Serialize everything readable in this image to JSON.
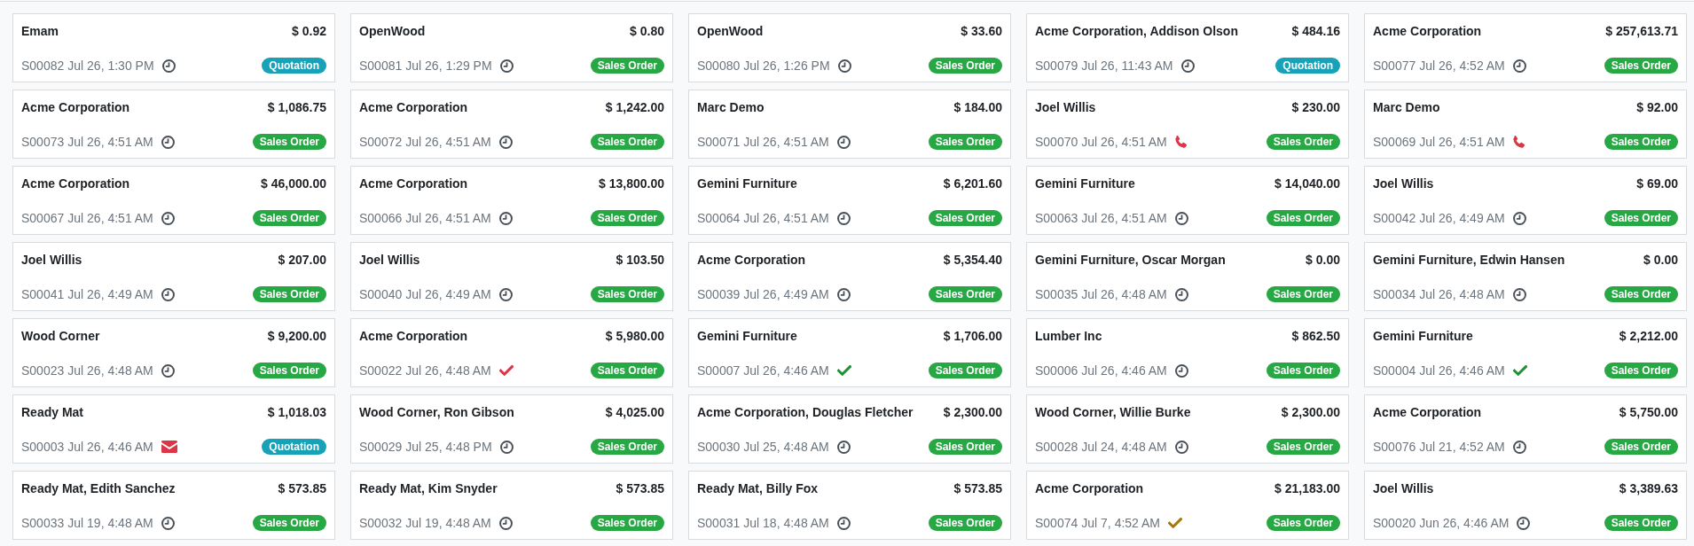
{
  "cards": [
    {
      "customer": "Emam",
      "amount": "$ 0.92",
      "reference": "S00082",
      "date": "Jul 26, 1:30 PM",
      "activity": {
        "kind": "clock",
        "color": "#495057"
      },
      "status": {
        "label": "Quotation",
        "kind": "quotation"
      }
    },
    {
      "customer": "OpenWood",
      "amount": "$ 0.80",
      "reference": "S00081",
      "date": "Jul 26, 1:29 PM",
      "activity": {
        "kind": "clock",
        "color": "#495057"
      },
      "status": {
        "label": "Sales Order",
        "kind": "sales_order"
      }
    },
    {
      "customer": "OpenWood",
      "amount": "$ 33.60",
      "reference": "S00080",
      "date": "Jul 26, 1:26 PM",
      "activity": {
        "kind": "clock",
        "color": "#495057"
      },
      "status": {
        "label": "Sales Order",
        "kind": "sales_order"
      }
    },
    {
      "customer": "Acme Corporation, Addison Olson",
      "amount": "$ 484.16",
      "reference": "S00079",
      "date": "Jul 26, 11:43 AM",
      "activity": {
        "kind": "clock",
        "color": "#495057"
      },
      "status": {
        "label": "Quotation",
        "kind": "quotation"
      }
    },
    {
      "customer": "Acme Corporation",
      "amount": "$ 257,613.71",
      "reference": "S00077",
      "date": "Jul 26, 4:52 AM",
      "activity": {
        "kind": "clock",
        "color": "#495057"
      },
      "status": {
        "label": "Sales Order",
        "kind": "sales_order"
      }
    },
    {
      "customer": "Acme Corporation",
      "amount": "$ 1,086.75",
      "reference": "S00073",
      "date": "Jul 26, 4:51 AM",
      "activity": {
        "kind": "clock",
        "color": "#495057"
      },
      "status": {
        "label": "Sales Order",
        "kind": "sales_order"
      }
    },
    {
      "customer": "Acme Corporation",
      "amount": "$ 1,242.00",
      "reference": "S00072",
      "date": "Jul 26, 4:51 AM",
      "activity": {
        "kind": "clock",
        "color": "#495057"
      },
      "status": {
        "label": "Sales Order",
        "kind": "sales_order"
      }
    },
    {
      "customer": "Marc Demo",
      "amount": "$ 184.00",
      "reference": "S00071",
      "date": "Jul 26, 4:51 AM",
      "activity": {
        "kind": "clock",
        "color": "#495057"
      },
      "status": {
        "label": "Sales Order",
        "kind": "sales_order"
      }
    },
    {
      "customer": "Joel Willis",
      "amount": "$ 230.00",
      "reference": "S00070",
      "date": "Jul 26, 4:51 AM",
      "activity": {
        "kind": "phone",
        "color": "#dc3545"
      },
      "status": {
        "label": "Sales Order",
        "kind": "sales_order"
      }
    },
    {
      "customer": "Marc Demo",
      "amount": "$ 92.00",
      "reference": "S00069",
      "date": "Jul 26, 4:51 AM",
      "activity": {
        "kind": "phone",
        "color": "#dc3545"
      },
      "status": {
        "label": "Sales Order",
        "kind": "sales_order"
      }
    },
    {
      "customer": "Acme Corporation",
      "amount": "$ 46,000.00",
      "reference": "S00067",
      "date": "Jul 26, 4:51 AM",
      "activity": {
        "kind": "clock",
        "color": "#495057"
      },
      "status": {
        "label": "Sales Order",
        "kind": "sales_order"
      }
    },
    {
      "customer": "Acme Corporation",
      "amount": "$ 13,800.00",
      "reference": "S00066",
      "date": "Jul 26, 4:51 AM",
      "activity": {
        "kind": "clock",
        "color": "#495057"
      },
      "status": {
        "label": "Sales Order",
        "kind": "sales_order"
      }
    },
    {
      "customer": "Gemini Furniture",
      "amount": "$ 6,201.60",
      "reference": "S00064",
      "date": "Jul 26, 4:51 AM",
      "activity": {
        "kind": "clock",
        "color": "#495057"
      },
      "status": {
        "label": "Sales Order",
        "kind": "sales_order"
      }
    },
    {
      "customer": "Gemini Furniture",
      "amount": "$ 14,040.00",
      "reference": "S00063",
      "date": "Jul 26, 4:51 AM",
      "activity": {
        "kind": "clock",
        "color": "#495057"
      },
      "status": {
        "label": "Sales Order",
        "kind": "sales_order"
      }
    },
    {
      "customer": "Joel Willis",
      "amount": "$ 69.00",
      "reference": "S00042",
      "date": "Jul 26, 4:49 AM",
      "activity": {
        "kind": "clock",
        "color": "#495057"
      },
      "status": {
        "label": "Sales Order",
        "kind": "sales_order"
      }
    },
    {
      "customer": "Joel Willis",
      "amount": "$ 207.00",
      "reference": "S00041",
      "date": "Jul 26, 4:49 AM",
      "activity": {
        "kind": "clock",
        "color": "#495057"
      },
      "status": {
        "label": "Sales Order",
        "kind": "sales_order"
      }
    },
    {
      "customer": "Joel Willis",
      "amount": "$ 103.50",
      "reference": "S00040",
      "date": "Jul 26, 4:49 AM",
      "activity": {
        "kind": "clock",
        "color": "#495057"
      },
      "status": {
        "label": "Sales Order",
        "kind": "sales_order"
      }
    },
    {
      "customer": "Acme Corporation",
      "amount": "$ 5,354.40",
      "reference": "S00039",
      "date": "Jul 26, 4:49 AM",
      "activity": {
        "kind": "clock",
        "color": "#495057"
      },
      "status": {
        "label": "Sales Order",
        "kind": "sales_order"
      }
    },
    {
      "customer": "Gemini Furniture, Oscar Morgan",
      "amount": "$ 0.00",
      "reference": "S00035",
      "date": "Jul 26, 4:48 AM",
      "activity": {
        "kind": "clock",
        "color": "#495057"
      },
      "status": {
        "label": "Sales Order",
        "kind": "sales_order"
      }
    },
    {
      "customer": "Gemini Furniture, Edwin Hansen",
      "amount": "$ 0.00",
      "reference": "S00034",
      "date": "Jul 26, 4:48 AM",
      "activity": {
        "kind": "clock",
        "color": "#495057"
      },
      "status": {
        "label": "Sales Order",
        "kind": "sales_order"
      }
    },
    {
      "customer": "Wood Corner",
      "amount": "$ 9,200.00",
      "reference": "S00023",
      "date": "Jul 26, 4:48 AM",
      "activity": {
        "kind": "clock",
        "color": "#495057"
      },
      "status": {
        "label": "Sales Order",
        "kind": "sales_order"
      }
    },
    {
      "customer": "Acme Corporation",
      "amount": "$ 5,980.00",
      "reference": "S00022",
      "date": "Jul 26, 4:48 AM",
      "activity": {
        "kind": "check",
        "color": "#dc3545"
      },
      "status": {
        "label": "Sales Order",
        "kind": "sales_order"
      }
    },
    {
      "customer": "Gemini Furniture",
      "amount": "$ 1,706.00",
      "reference": "S00007",
      "date": "Jul 26, 4:46 AM",
      "activity": {
        "kind": "check",
        "color": "#1e9234"
      },
      "status": {
        "label": "Sales Order",
        "kind": "sales_order"
      }
    },
    {
      "customer": "Lumber Inc",
      "amount": "$ 862.50",
      "reference": "S00006",
      "date": "Jul 26, 4:46 AM",
      "activity": {
        "kind": "clock",
        "color": "#495057"
      },
      "status": {
        "label": "Sales Order",
        "kind": "sales_order"
      }
    },
    {
      "customer": "Gemini Furniture",
      "amount": "$ 2,212.00",
      "reference": "S00004",
      "date": "Jul 26, 4:46 AM",
      "activity": {
        "kind": "check",
        "color": "#1e9234"
      },
      "status": {
        "label": "Sales Order",
        "kind": "sales_order"
      }
    },
    {
      "customer": "Ready Mat",
      "amount": "$ 1,018.03",
      "reference": "S00003",
      "date": "Jul 26, 4:46 AM",
      "activity": {
        "kind": "envelope",
        "color": "#dc3545"
      },
      "status": {
        "label": "Quotation",
        "kind": "quotation"
      }
    },
    {
      "customer": "Wood Corner, Ron Gibson",
      "amount": "$ 4,025.00",
      "reference": "S00029",
      "date": "Jul 25, 4:48 PM",
      "activity": {
        "kind": "clock",
        "color": "#495057"
      },
      "status": {
        "label": "Sales Order",
        "kind": "sales_order"
      }
    },
    {
      "customer": "Acme Corporation, Douglas Fletcher",
      "amount": "$ 2,300.00",
      "reference": "S00030",
      "date": "Jul 25, 4:48 AM",
      "activity": {
        "kind": "clock",
        "color": "#495057"
      },
      "status": {
        "label": "Sales Order",
        "kind": "sales_order"
      }
    },
    {
      "customer": "Wood Corner, Willie Burke",
      "amount": "$ 2,300.00",
      "reference": "S00028",
      "date": "Jul 24, 4:48 AM",
      "activity": {
        "kind": "clock",
        "color": "#495057"
      },
      "status": {
        "label": "Sales Order",
        "kind": "sales_order"
      }
    },
    {
      "customer": "Acme Corporation",
      "amount": "$ 5,750.00",
      "reference": "S00076",
      "date": "Jul 21, 4:52 AM",
      "activity": {
        "kind": "clock",
        "color": "#495057"
      },
      "status": {
        "label": "Sales Order",
        "kind": "sales_order"
      }
    },
    {
      "customer": "Ready Mat, Edith Sanchez",
      "amount": "$ 573.85",
      "reference": "S00033",
      "date": "Jul 19, 4:48 AM",
      "activity": {
        "kind": "clock",
        "color": "#495057"
      },
      "status": {
        "label": "Sales Order",
        "kind": "sales_order"
      }
    },
    {
      "customer": "Ready Mat, Kim Snyder",
      "amount": "$ 573.85",
      "reference": "S00032",
      "date": "Jul 19, 4:48 AM",
      "activity": {
        "kind": "clock",
        "color": "#495057"
      },
      "status": {
        "label": "Sales Order",
        "kind": "sales_order"
      }
    },
    {
      "customer": "Ready Mat, Billy Fox",
      "amount": "$ 573.85",
      "reference": "S00031",
      "date": "Jul 18, 4:48 AM",
      "activity": {
        "kind": "clock",
        "color": "#495057"
      },
      "status": {
        "label": "Sales Order",
        "kind": "sales_order"
      }
    },
    {
      "customer": "Acme Corporation",
      "amount": "$ 21,183.00",
      "reference": "S00074",
      "date": "Jul 7, 4:52 AM",
      "activity": {
        "kind": "check",
        "color": "#a5780c"
      },
      "status": {
        "label": "Sales Order",
        "kind": "sales_order"
      }
    },
    {
      "customer": "Joel Willis",
      "amount": "$ 3,389.63",
      "reference": "S00020",
      "date": "Jun 26, 4:46 AM",
      "activity": {
        "kind": "clock",
        "color": "#495057"
      },
      "status": {
        "label": "Sales Order",
        "kind": "sales_order"
      }
    }
  ]
}
